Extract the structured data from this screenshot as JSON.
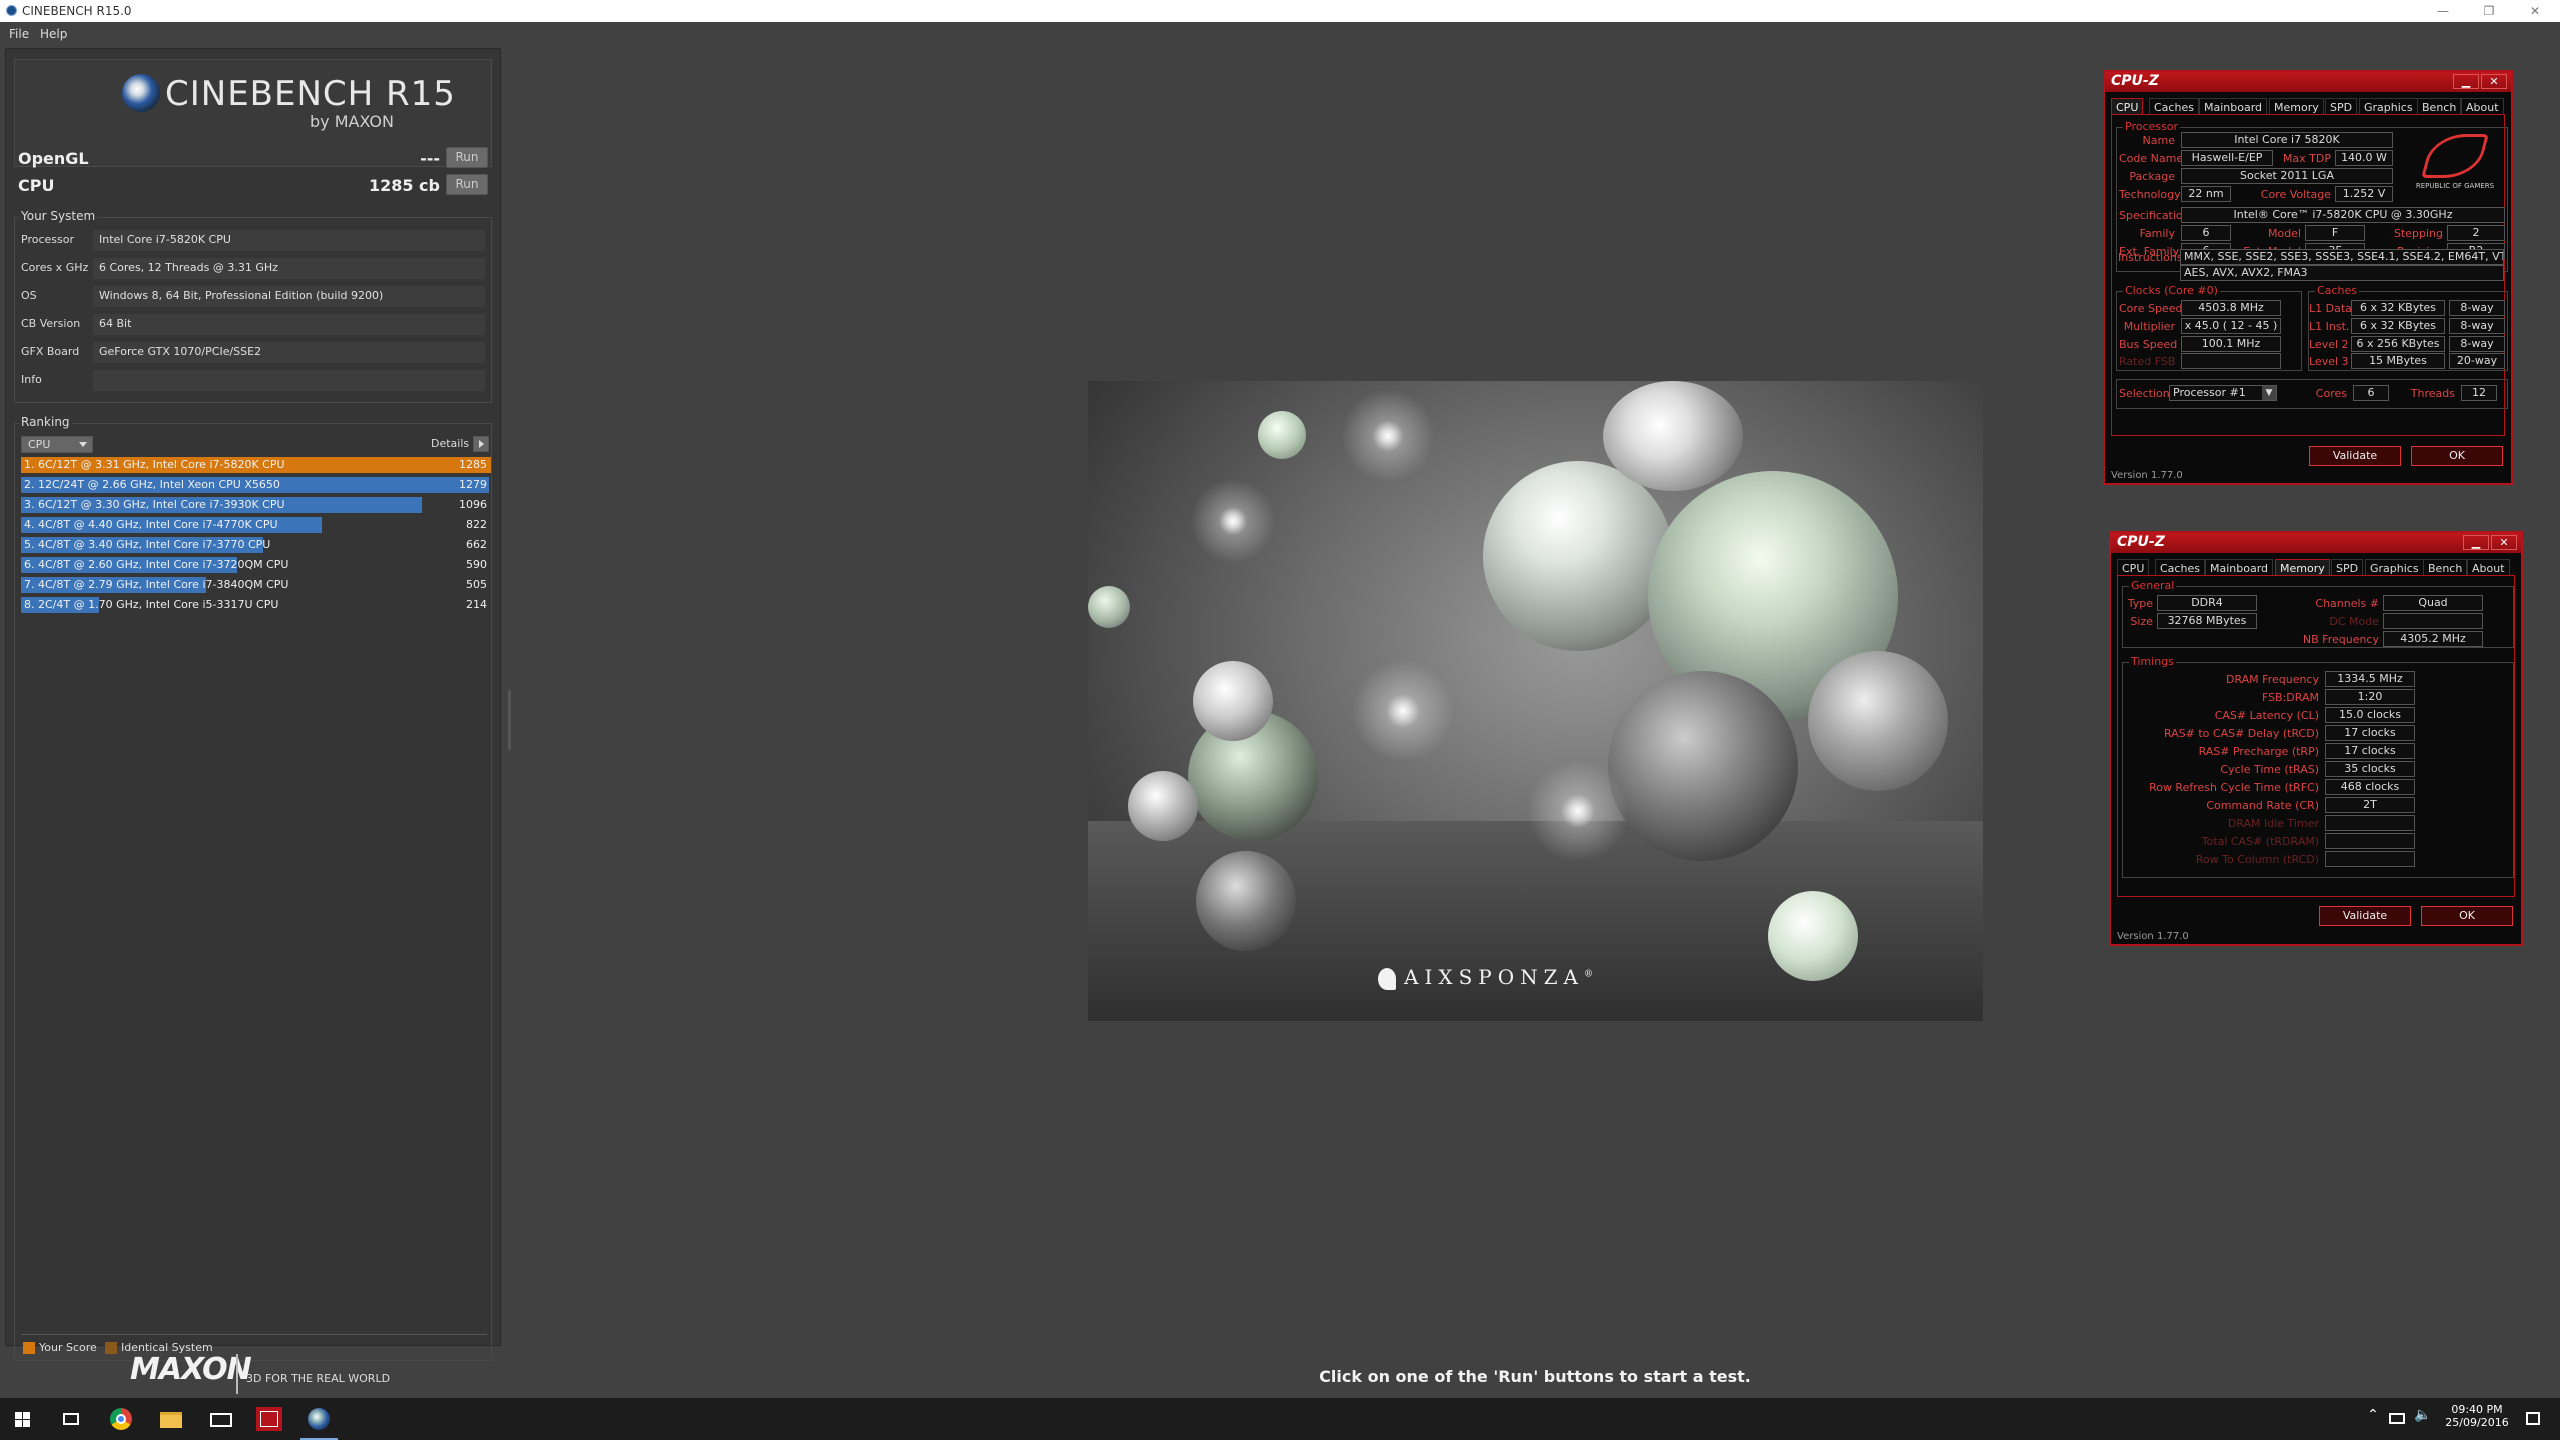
{
  "window": {
    "title": "CINEBENCH R15.0",
    "controls": {
      "min": "—",
      "max": "❐",
      "close": "✕"
    }
  },
  "menu": {
    "file": "File",
    "help": "Help"
  },
  "logo": {
    "name": "CINEBENCH R15",
    "by": "by MAXON"
  },
  "scores": {
    "opengl_label": "OpenGL",
    "opengl_value": "---",
    "cpu_label": "CPU",
    "cpu_value": "1285 cb",
    "run_label": "Run"
  },
  "system": {
    "title": "Your System",
    "rows": [
      {
        "k": "Processor",
        "v": "Intel Core i7-5820K CPU"
      },
      {
        "k": "Cores x GHz",
        "v": "6 Cores, 12 Threads @ 3.31 GHz"
      },
      {
        "k": "OS",
        "v": "Windows 8, 64 Bit, Professional Edition (build 9200)"
      },
      {
        "k": "CB Version",
        "v": "64 Bit"
      },
      {
        "k": "GFX Board",
        "v": "GeForce GTX 1070/PCIe/SSE2"
      },
      {
        "k": "Info",
        "v": ""
      }
    ]
  },
  "ranking": {
    "title": "Ranking",
    "dropdown": "CPU",
    "details": "Details",
    "max_score": 1285,
    "rows": [
      {
        "label": "1. 6C/12T @ 3.31 GHz, Intel Core i7-5820K CPU",
        "score": 1285
      },
      {
        "label": "2. 12C/24T @ 2.66 GHz, Intel Xeon CPU X5650",
        "score": 1279
      },
      {
        "label": "3. 6C/12T @ 3.30 GHz,  Intel Core i7-3930K CPU",
        "score": 1096
      },
      {
        "label": "4. 4C/8T @ 4.40 GHz, Intel Core i7-4770K CPU",
        "score": 822
      },
      {
        "label": "5. 4C/8T @ 3.40 GHz,  Intel Core i7-3770 CPU",
        "score": 662
      },
      {
        "label": "6. 4C/8T @ 2.60 GHz, Intel Core i7-3720QM CPU",
        "score": 590
      },
      {
        "label": "7. 4C/8T @ 2.79 GHz,  Intel Core i7-3840QM CPU",
        "score": 505
      },
      {
        "label": "8. 2C/4T @ 1.70 GHz,  Intel Core i5-3317U CPU",
        "score": 214
      }
    ],
    "legend": {
      "your_score": "Your Score",
      "identical": "Identical System"
    }
  },
  "brand": {
    "maxon": "MAXON",
    "tagline": "3D FOR THE REAL WORLD"
  },
  "render": {
    "logo_text": "AIXSPONZA",
    "mark": "®"
  },
  "hint": "Click on one of the 'Run' buttons to start a test.",
  "colors": {
    "your_score": "#d6780e",
    "identical": "#8a5a1a",
    "bar": "#3b74b8",
    "cpuz_red": "#b3141b"
  },
  "cpuz1": {
    "title": "CPU-Z",
    "tabs": [
      "CPU",
      "Caches",
      "Mainboard",
      "Memory",
      "SPD",
      "Graphics",
      "Bench",
      "About"
    ],
    "active_tab": "CPU",
    "processor_title": "Processor",
    "name_l": "Name",
    "name": "Intel Core i7 5820K",
    "code_l": "Code Name",
    "code": "Haswell-E/EP",
    "tdp_l": "Max TDP",
    "tdp": "140.0 W",
    "pkg_l": "Package",
    "pkg": "Socket 2011 LGA",
    "tech_l": "Technology",
    "tech": "22 nm",
    "volt_l": "Core Voltage",
    "volt": "1.252 V",
    "spec_l": "Specification",
    "spec": "Intel® Core™ i7-5820K CPU @ 3.30GHz",
    "fam_l": "Family",
    "fam": "6",
    "model_l": "Model",
    "model": "F",
    "step_l": "Stepping",
    "step": "2",
    "extfam_l": "Ext. Family",
    "extfam": "6",
    "extmod_l": "Ext. Model",
    "extmod": "3F",
    "rev_l": "Revision",
    "rev": "R2",
    "inst_l": "Instructions",
    "inst1": "MMX, SSE, SSE2, SSE3, SSSE3, SSE4.1, SSE4.2, EM64T, VT-x,",
    "inst2": "AES, AVX, AVX2, FMA3",
    "rog": "REPUBLIC OF GAMERS",
    "clocks_title": "Clocks (Core #0)",
    "cs_l": "Core Speed",
    "cs": "4503.8 MHz",
    "mult_l": "Multiplier",
    "mult": "x 45.0 ( 12 - 45 )",
    "bus_l": "Bus Speed",
    "bus": "100.1 MHz",
    "fsb_l": "Rated FSB",
    "caches_title": "Caches",
    "l1d_l": "L1 Data",
    "l1d": "6 x 32 KBytes",
    "l1d_w": "8-way",
    "l1i_l": "L1 Inst.",
    "l1i": "6 x 32 KBytes",
    "l1i_w": "8-way",
    "l2_l": "Level 2",
    "l2": "6 x 256 KBytes",
    "l2_w": "8-way",
    "l3_l": "Level 3",
    "l3": "15 MBytes",
    "l3_w": "20-way",
    "sel_l": "Selection",
    "sel": "Processor #1",
    "cores_l": "Cores",
    "cores": "6",
    "threads_l": "Threads",
    "threads": "12",
    "validate": "Validate",
    "ok": "OK",
    "version": "Version 1.77.0"
  },
  "cpuz2": {
    "title": "CPU-Z",
    "tabs": [
      "CPU",
      "Caches",
      "Mainboard",
      "Memory",
      "SPD",
      "Graphics",
      "Bench",
      "About"
    ],
    "active_tab": "Memory",
    "general_title": "General",
    "type_l": "Type",
    "type": "DDR4",
    "chan_l": "Channels #",
    "chan": "Quad",
    "size_l": "Size",
    "size": "32768 MBytes",
    "dc_l": "DC Mode",
    "nb_l": "NB Frequency",
    "nb": "4305.2 MHz",
    "timings_title": "Timings",
    "timings": [
      {
        "l": "DRAM Frequency",
        "v": "1334.5 MHz"
      },
      {
        "l": "FSB:DRAM",
        "v": "1:20"
      },
      {
        "l": "CAS# Latency (CL)",
        "v": "15.0 clocks"
      },
      {
        "l": "RAS# to CAS# Delay (tRCD)",
        "v": "17 clocks"
      },
      {
        "l": "RAS# Precharge (tRP)",
        "v": "17 clocks"
      },
      {
        "l": "Cycle Time (tRAS)",
        "v": "35 clocks"
      },
      {
        "l": "Row Refresh Cycle Time (tRFC)",
        "v": "468 clocks"
      },
      {
        "l": "Command Rate (CR)",
        "v": "2T"
      },
      {
        "l": "DRAM Idle Timer",
        "v": ""
      },
      {
        "l": "Total CAS# (tRDRAM)",
        "v": ""
      },
      {
        "l": "Row To Column (tRCD)",
        "v": ""
      }
    ],
    "validate": "Validate",
    "ok": "OK",
    "version": "Version 1.77.0"
  },
  "taskbar": {
    "time": "09:40 PM",
    "date": "25/09/2016"
  }
}
